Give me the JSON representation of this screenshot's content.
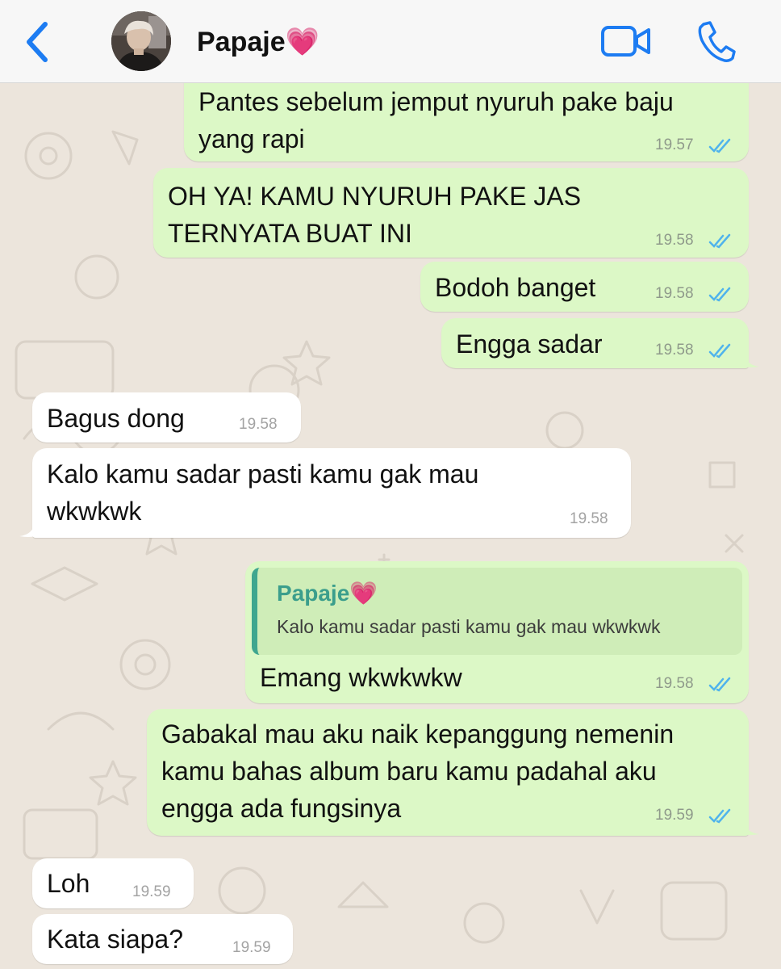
{
  "header": {
    "back_icon": "chevron-left-icon",
    "contact_name": "Papaje💗",
    "video_icon": "video-camera-icon",
    "call_icon": "phone-icon",
    "accent_color": "#1d7cf2"
  },
  "messages": [
    {
      "direction": "outgoing",
      "text": "Pantes sebelum jemput nyuruh pake baju\nyang rapi",
      "time": "19.57",
      "status": "read"
    },
    {
      "direction": "outgoing",
      "text": "OH YA! KAMU NYURUH PAKE JAS\nTERNYATA BUAT INI",
      "time": "19.58",
      "status": "read"
    },
    {
      "direction": "outgoing",
      "text": "Bodoh banget",
      "time": "19.58",
      "status": "read"
    },
    {
      "direction": "outgoing",
      "text": "Engga sadar",
      "time": "19.58",
      "status": "read"
    },
    {
      "direction": "incoming",
      "text": "Bagus dong",
      "time": "19.58"
    },
    {
      "direction": "incoming",
      "text": "Kalo kamu sadar pasti kamu gak mau\nwkwkwk",
      "time": "19.58"
    },
    {
      "direction": "outgoing",
      "reply_to": {
        "name": "Papaje💗",
        "text": "Kalo kamu sadar pasti kamu gak mau wkwkwk"
      },
      "text": "Emang wkwkwkw",
      "time": "19.58",
      "status": "read"
    },
    {
      "direction": "outgoing",
      "text": "Gabakal mau aku naik kepanggung nemenin\nkamu bahas album baru kamu padahal aku\nengga ada fungsinya",
      "time": "19.59",
      "status": "read"
    },
    {
      "direction": "incoming",
      "text": "Loh",
      "time": "19.59"
    },
    {
      "direction": "incoming",
      "text": "Kata siapa?",
      "time": "19.59"
    }
  ],
  "colors": {
    "outgoing_bubble": "#dcf8c6",
    "incoming_bubble": "#ffffff",
    "read_ticks": "#4fb3ec",
    "quote_accent": "#3fa68f",
    "wallpaper": "#ece5dc"
  }
}
